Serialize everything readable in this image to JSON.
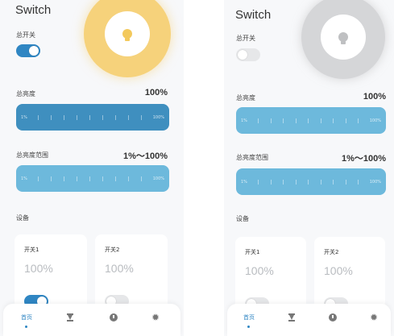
{
  "title": "Switch",
  "master_switch_label": "总开关",
  "brightness_label": "总亮度",
  "brightness_value": "100%",
  "range_label": "总亮度范围",
  "range_value": "1%～100%",
  "slider_min": "1%",
  "slider_max": "100%",
  "devices_label": "设备",
  "devices": [
    {
      "name": "开关1",
      "value": "100%"
    },
    {
      "name": "开关2",
      "value": "100%"
    }
  ],
  "nav": {
    "home": "首页",
    "hourglass": "hourglass-icon",
    "clock": "clock-icon",
    "gear": "gear-icon"
  },
  "left_state": {
    "master_on": true,
    "device1_on": true,
    "device2_on": false,
    "brightness": 1.0
  },
  "right_state": {
    "master_on": false,
    "device1_on": false,
    "device2_on": false,
    "brightness": 1.0
  },
  "colors": {
    "accent": "#2f86c3",
    "lamp_on": "#f6d27b",
    "lamp_off": "#d5d6d8",
    "slider_dark": "#3f8fbf",
    "slider_light": "#6db9dc"
  }
}
